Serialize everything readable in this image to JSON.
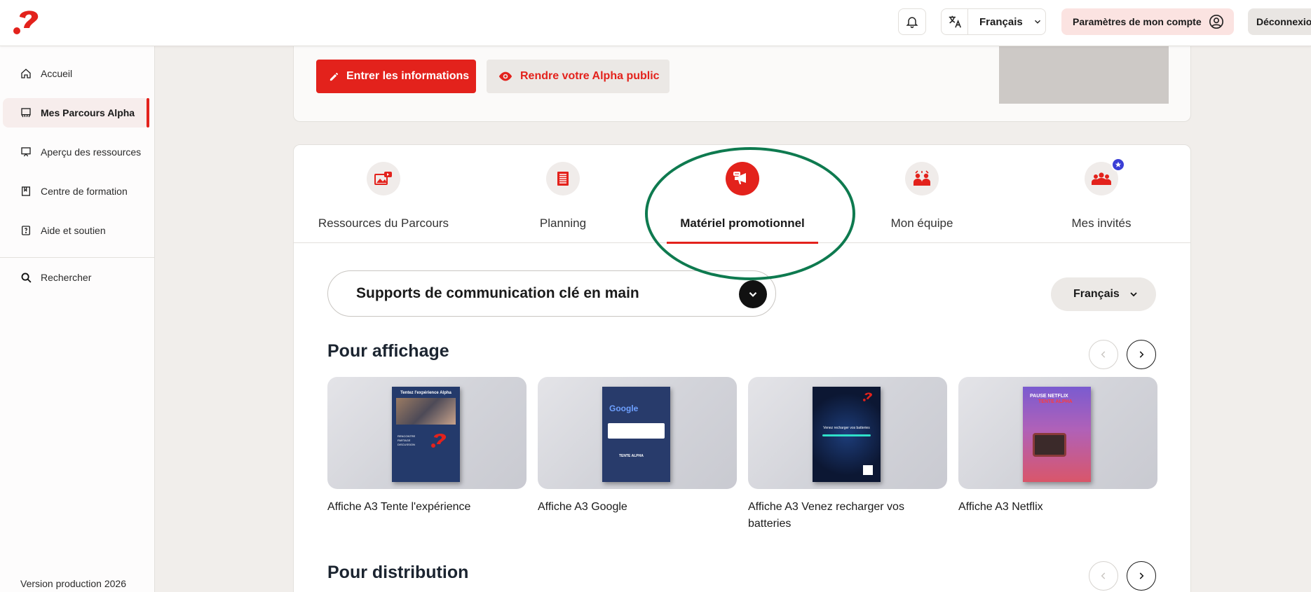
{
  "header": {
    "language": "Français",
    "account_label": "Paramètres de mon compte",
    "logout_label": "Déconnexion"
  },
  "sidebar": {
    "items": [
      {
        "label": "Accueil",
        "icon": "home-icon"
      },
      {
        "label": "Mes Parcours Alpha",
        "icon": "parcours-icon",
        "active": true
      },
      {
        "label": "Aperçu des ressources",
        "icon": "resources-icon"
      },
      {
        "label": "Centre de formation",
        "icon": "book-icon"
      },
      {
        "label": "Aide et soutien",
        "icon": "help-icon"
      }
    ],
    "search_label": "Rechercher",
    "version": "Version production 2026"
  },
  "top_card": {
    "enter_info_label": "Entrer les informations",
    "make_public_label": "Rendre votre Alpha public"
  },
  "tabs": [
    {
      "label": "Ressources du Parcours",
      "icon": "media-icon"
    },
    {
      "label": "Planning",
      "icon": "planning-icon"
    },
    {
      "label": "Matériel promotionnel",
      "icon": "megaphone-icon",
      "active": true
    },
    {
      "label": "Mon équipe",
      "icon": "team-icon"
    },
    {
      "label": "Mes invités",
      "icon": "guests-icon"
    }
  ],
  "filters": {
    "category_select": "Supports de communication clé en main",
    "language_select": "Français"
  },
  "sections": {
    "display_title": "Pour affichage",
    "distribution_title": "Pour distribution"
  },
  "posters": [
    {
      "title": "Affiche A3 Tente l'expérience",
      "header_text": "Tentez l'expérience Alpha",
      "body_text": "RENCONTRE\nPARTAGE\nDISCUSSION",
      "bg": "#243a6b"
    },
    {
      "title": "Affiche A3 Google",
      "header_text": "Google",
      "body_text": "TENTE ALPHA",
      "bg": "#283b6b"
    },
    {
      "title": "Affiche A3 Venez recharger vos batteries",
      "header_text": "Venez recharger vos batteries",
      "body_text": "",
      "bg": "#0f1f3f"
    },
    {
      "title": "Affiche A3 Netflix",
      "header_text": "PAUSE NETFLIX",
      "body_text": "TENTE ALPHA",
      "bg": "#7a4bb0"
    }
  ],
  "colors": {
    "brand_red": "#e3221c",
    "annotation_green": "#0e7a4f"
  }
}
